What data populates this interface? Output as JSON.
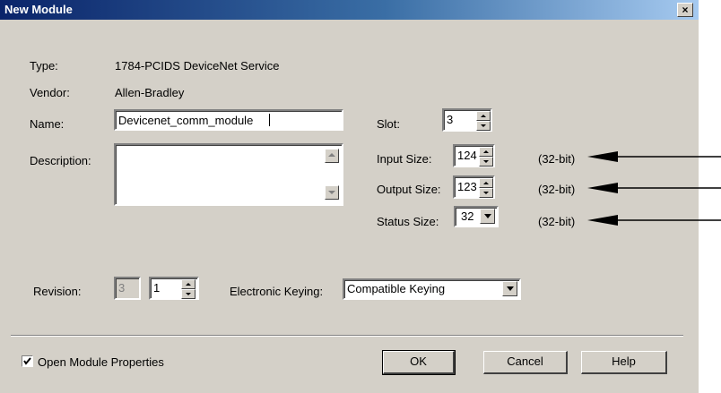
{
  "window": {
    "title": "New Module",
    "close_glyph": "×"
  },
  "fields": {
    "type_label": "Type:",
    "type_value": "1784-PCIDS DeviceNet Service",
    "vendor_label": "Vendor:",
    "vendor_value": "Allen-Bradley",
    "name_label": "Name:",
    "name_value": "Devicenet_comm_module",
    "description_label": "Description:",
    "description_value": "",
    "slot_label": "Slot:",
    "slot_value": "3",
    "input_size_label": "Input Size:",
    "input_size_value": "124",
    "input_size_unit": "(32-bit)",
    "output_size_label": "Output Size:",
    "output_size_value": "123",
    "output_size_unit": "(32-bit)",
    "status_size_label": "Status Size:",
    "status_size_value": "32",
    "status_size_unit": "(32-bit)",
    "revision_label": "Revision:",
    "revision_major": "3",
    "revision_minor": "1",
    "keying_label": "Electronic Keying:",
    "keying_value": "Compatible Keying"
  },
  "footer": {
    "open_props_label": "Open Module Properties",
    "open_props_checked": true,
    "ok_label": "OK",
    "cancel_label": "Cancel",
    "help_label": "Help"
  },
  "colors": {
    "dialog_bg": "#d4d0c8",
    "title_gradient_start": "#0a246a",
    "title_gradient_end": "#a6caf0"
  },
  "annotations": {
    "arrow_icon": "left-arrow"
  }
}
